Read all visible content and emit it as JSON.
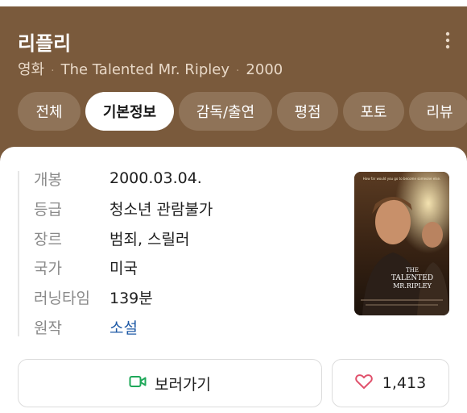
{
  "header": {
    "title": "리플리",
    "subtitle_items": [
      "영화",
      "The Talented Mr. Ripley",
      "2000"
    ],
    "separator": "·"
  },
  "tabs": [
    {
      "label": "전체",
      "active": false
    },
    {
      "label": "기본정보",
      "active": true
    },
    {
      "label": "감독/출연",
      "active": false
    },
    {
      "label": "평점",
      "active": false
    },
    {
      "label": "포토",
      "active": false
    },
    {
      "label": "리뷰",
      "active": false
    }
  ],
  "info": [
    {
      "label": "개봉",
      "value": "2000.03.04."
    },
    {
      "label": "등급",
      "value": "청소년 관람불가"
    },
    {
      "label": "장르",
      "value": "범죄, 스릴러"
    },
    {
      "label": "국가",
      "value": "미국"
    },
    {
      "label": "러닝타임",
      "value": "139분"
    },
    {
      "label": "원작",
      "value": "소설"
    }
  ],
  "poster": {
    "tagline": "How far would you go to become someone else.",
    "title_line1": "THE",
    "title_line2": "TALENTED",
    "title_line3": "MR.RIPLEY"
  },
  "actions": {
    "watch_label": "보러가기",
    "like_count": "1,413"
  },
  "colors": {
    "header_bg": "#7a5a3c",
    "tab_bg": "#8f7358",
    "link": "#1f5aa6",
    "heart": "#e0506b",
    "watch_icon": "#1fa85a"
  }
}
